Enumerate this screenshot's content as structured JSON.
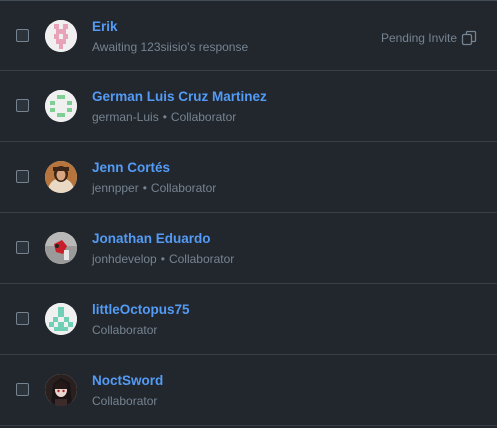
{
  "members": [
    {
      "name": "Erik",
      "subtitle": "Awaiting 123siisio's response",
      "status": "Pending Invite",
      "avatar_icon": "identicon-pink"
    },
    {
      "name": "German Luis Cruz Martinez",
      "username": "german-Luis",
      "role": "Collaborator",
      "avatar_icon": "identicon-green"
    },
    {
      "name": "Jenn Cortés",
      "username": "jennpper",
      "role": "Collaborator",
      "avatar_icon": "photo-avatar"
    },
    {
      "name": "Jonathan Eduardo",
      "username": "jonhdevelop",
      "role": "Collaborator",
      "avatar_icon": "photo-avatar"
    },
    {
      "name": "littleOctopus75",
      "role": "Collaborator",
      "avatar_icon": "identicon-teal"
    },
    {
      "name": "NoctSword",
      "role": "Collaborator",
      "avatar_icon": "photo-avatar"
    }
  ],
  "separator": "•",
  "colors": {
    "background": "#22272e",
    "link": "#539bf5",
    "muted": "#768390",
    "divider": "#373e47"
  }
}
